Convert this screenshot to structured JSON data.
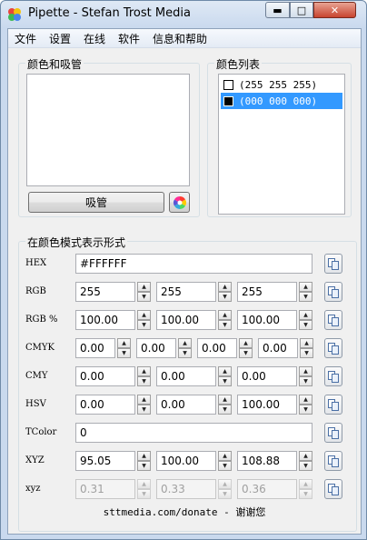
{
  "window": {
    "title": "Pipette - Stefan Trost Media"
  },
  "menu": [
    "文件",
    "设置",
    "在线",
    "软件",
    "信息和帮助"
  ],
  "picker": {
    "group_title": "颜色和吸管",
    "pick_button": "吸管"
  },
  "color_list": {
    "group_title": "颜色列表",
    "items": [
      {
        "label": "(255 255 255)",
        "swatch": "#ffffff",
        "selected": false
      },
      {
        "label": "(000 000 000)",
        "swatch": "#000000",
        "selected": true
      }
    ]
  },
  "formats": {
    "group_title": "在颜色模式表示形式",
    "rows": [
      {
        "label": "HEX",
        "values": [
          "#FFFFFF"
        ]
      },
      {
        "label": "RGB",
        "values": [
          "255",
          "255",
          "255"
        ]
      },
      {
        "label": "RGB %",
        "values": [
          "100.00",
          "100.00",
          "100.00"
        ]
      },
      {
        "label": "CMYK",
        "values": [
          "0.00",
          "0.00",
          "0.00",
          "0.00"
        ]
      },
      {
        "label": "CMY",
        "values": [
          "0.00",
          "0.00",
          "0.00"
        ]
      },
      {
        "label": "HSV",
        "values": [
          "0.00",
          "0.00",
          "100.00"
        ]
      },
      {
        "label": "TColor",
        "values": [
          "0"
        ]
      },
      {
        "label": "XYZ",
        "values": [
          "95.05",
          "100.00",
          "108.88"
        ]
      },
      {
        "label": "xyz",
        "values": [
          "0.31",
          "0.33",
          "0.36"
        ],
        "disabled": true
      }
    ]
  },
  "footer": "sttmedia.com/donate - 谢谢您",
  "colors": {
    "selection": "#3399ff",
    "close_button": "#c8442f"
  }
}
